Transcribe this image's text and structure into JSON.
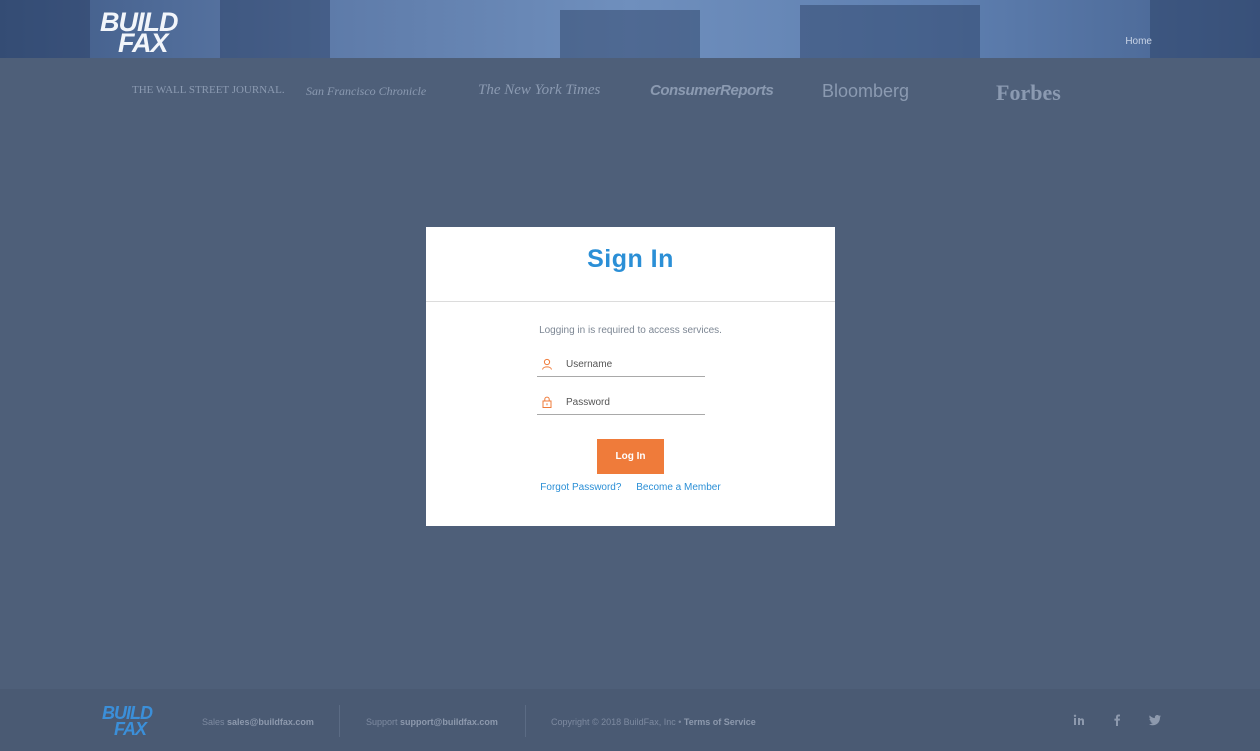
{
  "header": {
    "logo_line1": "BUILD",
    "logo_line2": "FAX",
    "nav_home": "Home"
  },
  "press": [
    {
      "name": "THE WALL STREET JOURNAL."
    },
    {
      "name": "San Francisco Chronicle"
    },
    {
      "name": "The New York Times"
    },
    {
      "name": "ConsumerReports"
    },
    {
      "name": "Bloomberg"
    },
    {
      "name": "Forbes"
    }
  ],
  "signin": {
    "title": "Sign In",
    "hint": "Logging in is required to access services.",
    "username_placeholder": "Username",
    "password_placeholder": "Password",
    "login_label": "Log In",
    "forgot_label": "Forgot Password?",
    "member_label": "Become a Member"
  },
  "footer": {
    "logo_line1": "BUILD",
    "logo_line2": "FAX",
    "sales_label": "Sales",
    "sales_email": "sales@buildfax.com",
    "support_label": "Support",
    "support_email": "support@buildfax.com",
    "copyright": "Copyright © 2018 BuildFax, Inc •",
    "terms": "Terms of Service",
    "social": [
      "linkedin-icon",
      "facebook-icon",
      "twitter-icon"
    ]
  },
  "colors": {
    "accent_blue": "#2b8fd6",
    "login_orange": "#ef7b3a",
    "overlay": "#4e5f79"
  }
}
